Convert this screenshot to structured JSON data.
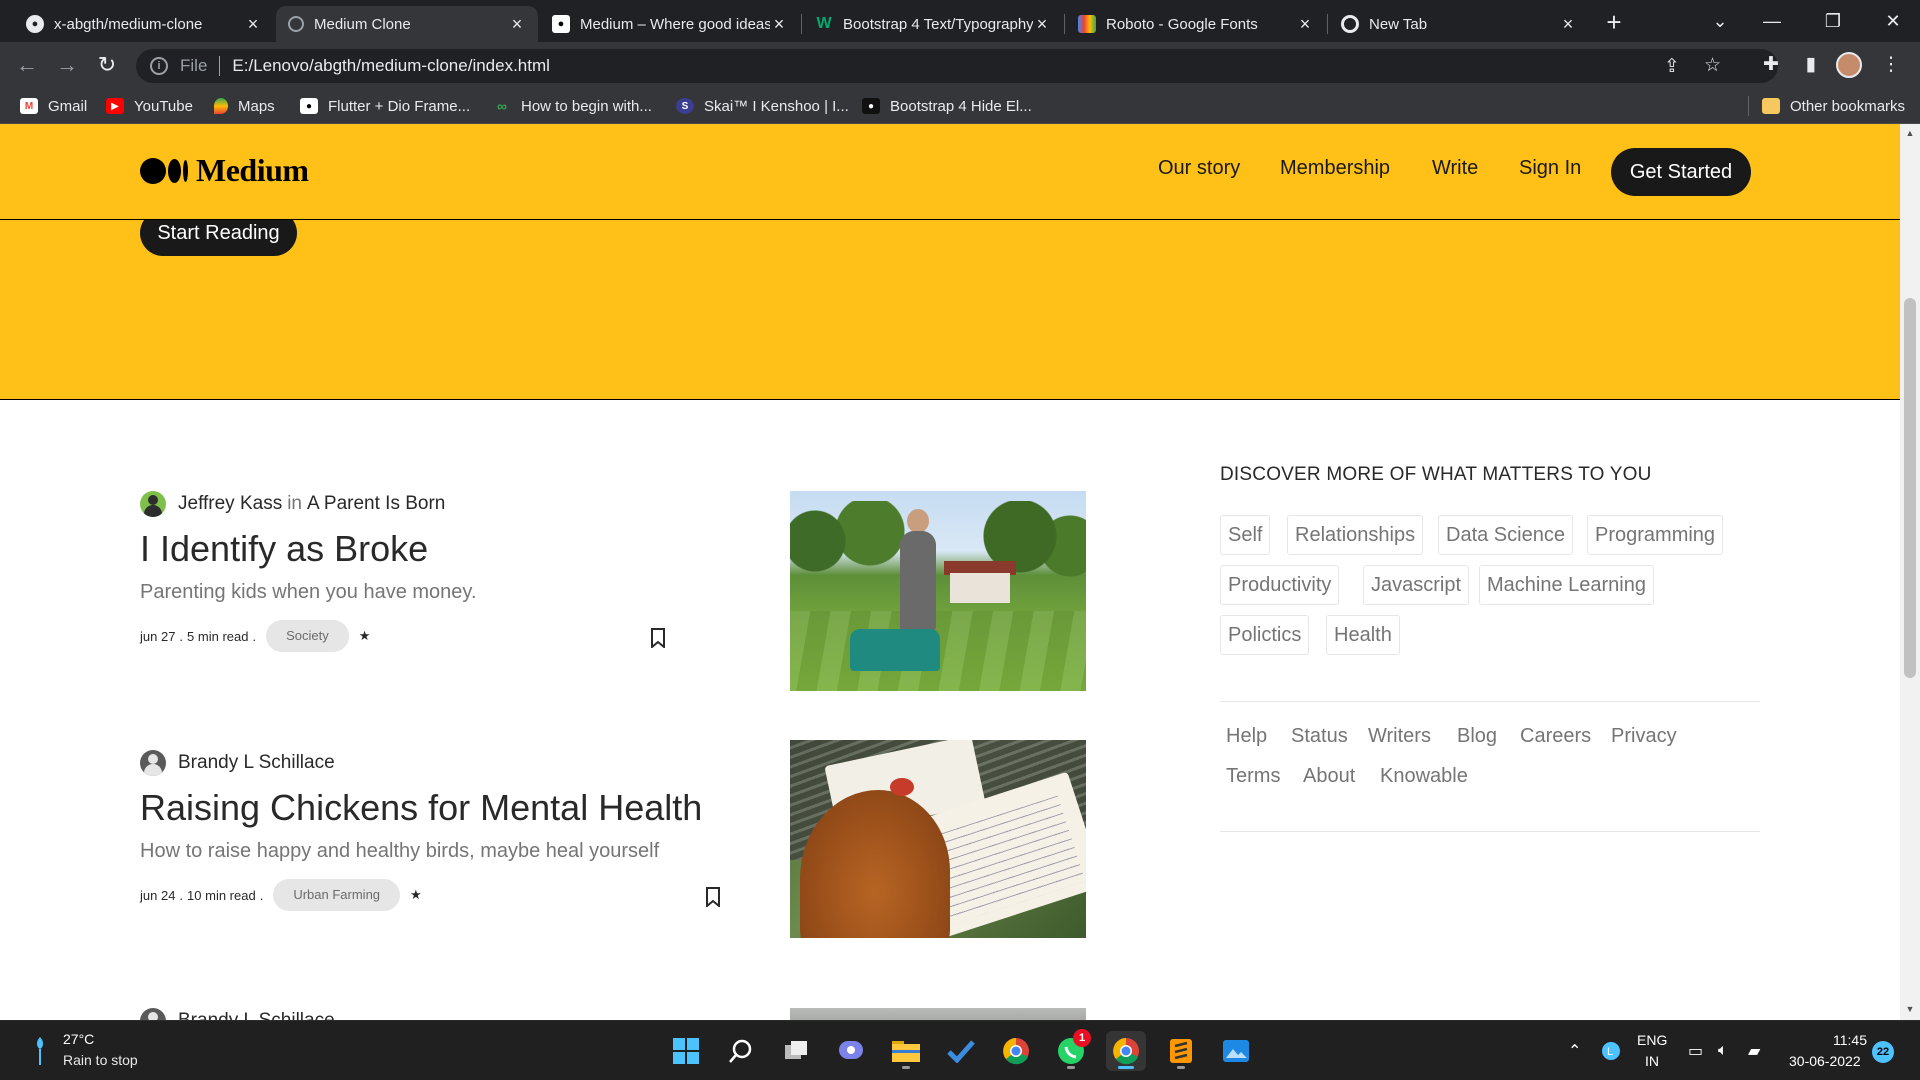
{
  "browser": {
    "tabs": [
      {
        "label": "x-abgth/medium-clone",
        "icon": "github-icon",
        "active": false
      },
      {
        "label": "Medium Clone",
        "icon": "globe-icon",
        "active": true
      },
      {
        "label": "Medium – Where good ideas find you",
        "icon": "medium-icon",
        "active": false
      },
      {
        "label": "Bootstrap 4 Text/Typography",
        "icon": "w3schools-icon",
        "active": false
      },
      {
        "label": "Roboto - Google Fonts",
        "icon": "google-fonts-icon",
        "active": false
      },
      {
        "label": "New Tab",
        "icon": "chrome-icon",
        "active": false
      }
    ],
    "address_scheme": "File",
    "address_url": "E:/Lenovo/abgth/medium-clone/index.html",
    "bookmarks": [
      {
        "label": "Gmail",
        "icon": "gmail-icon"
      },
      {
        "label": "YouTube",
        "icon": "youtube-icon"
      },
      {
        "label": "Maps",
        "icon": "maps-icon"
      },
      {
        "label": "Flutter + Dio Frame...",
        "icon": "medium-icon"
      },
      {
        "label": "How to begin with...",
        "icon": "link-icon"
      },
      {
        "label": "Skai™ I Kenshoo | I...",
        "icon": "skai-icon"
      },
      {
        "label": "Bootstrap 4 Hide El...",
        "icon": "bootstrap-icon"
      }
    ],
    "other_bookmarks": "Other bookmarks"
  },
  "site": {
    "logo_text": "Medium",
    "nav": [
      "Our story",
      "Membership",
      "Write",
      "Sign In"
    ],
    "cta": "Get Started",
    "hero_button": "Start Reading",
    "brand_color": "#ffc017"
  },
  "articles": [
    {
      "author": "Jeffrey Kass",
      "in_word": "in",
      "publication": "A Parent Is Born",
      "title": "I Identify as Broke",
      "subtitle": "Parenting kids when you have money.",
      "date": "jun 27",
      "read_time": "5 min read",
      "tag": "Society"
    },
    {
      "author": "Brandy L Schillace",
      "in_word": "",
      "publication": "",
      "title": "Raising Chickens for Mental Health",
      "subtitle": "How to raise happy and healthy birds, maybe heal yourself",
      "date": "jun 24",
      "read_time": "10 min read",
      "tag": "Urban Farming"
    },
    {
      "author": "Brandy L Schillace"
    }
  ],
  "sidebar": {
    "heading": "DISCOVER MORE OF WHAT MATTERS TO YOU",
    "topics": [
      "Self",
      "Relationships",
      "Data Science",
      "Programming",
      "Productivity",
      "Javascript",
      "Machine Learning",
      "Polictics",
      "Health"
    ],
    "footer_links": [
      "Help",
      "Status",
      "Writers",
      "Blog",
      "Careers",
      "Privacy",
      "Terms",
      "About",
      "Knowable"
    ]
  },
  "taskbar": {
    "weather_temp": "27°C",
    "weather_desc": "Rain to stop",
    "whatsapp_badge": "1",
    "lang_top": "ENG",
    "lang_bottom": "IN",
    "time": "11:45",
    "date": "30-06-2022",
    "notifications": "22"
  }
}
